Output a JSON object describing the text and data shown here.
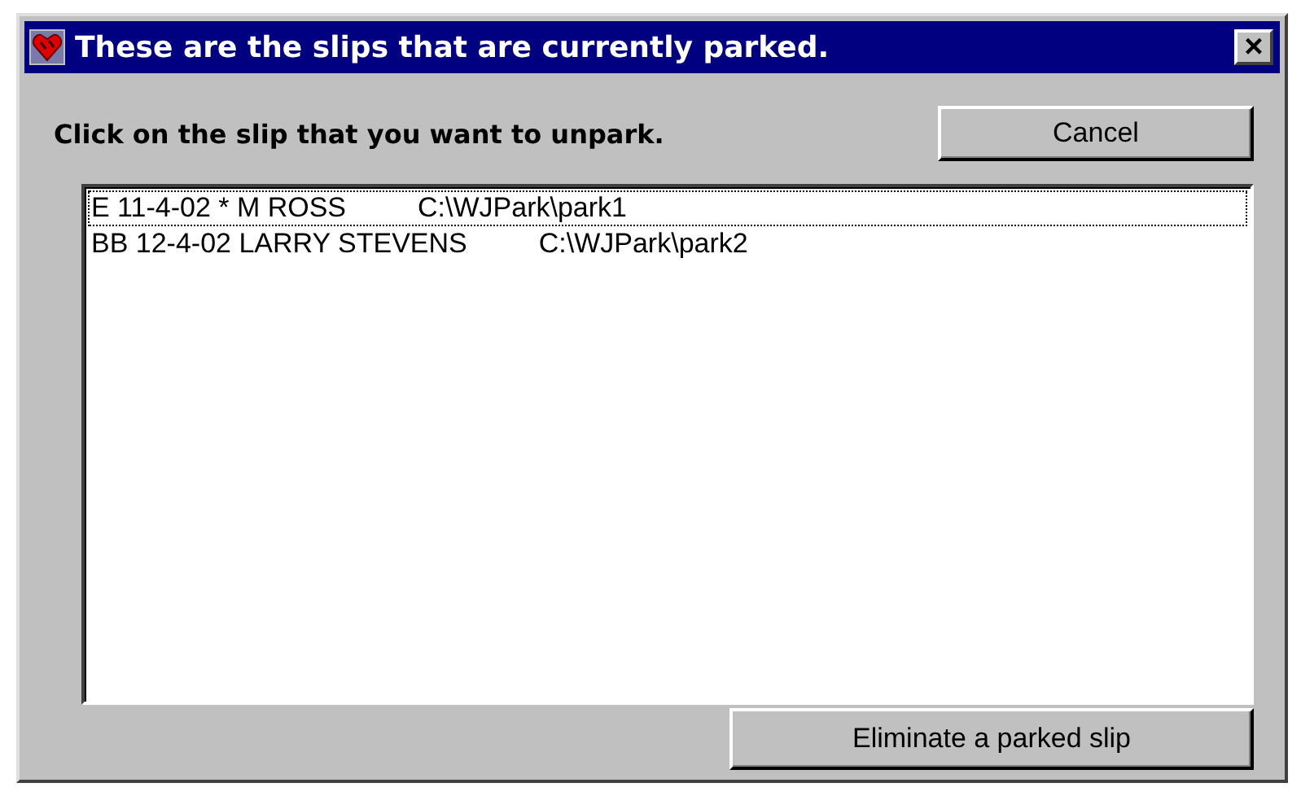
{
  "window": {
    "title": "These are the slips that are currently parked.",
    "close": "×"
  },
  "instruction": "Click on the slip that you want to unpark.",
  "cancel_button": "Cancel",
  "slips": [
    {
      "name": "E 11-4-02 * M ROSS",
      "path": "C:\\WJPark\\park1",
      "focused": true
    },
    {
      "name": "BB 12-4-02 LARRY STEVENS",
      "path": "C:\\WJPark\\park2",
      "focused": false
    }
  ],
  "eliminate_button": "Eliminate a parked slip"
}
